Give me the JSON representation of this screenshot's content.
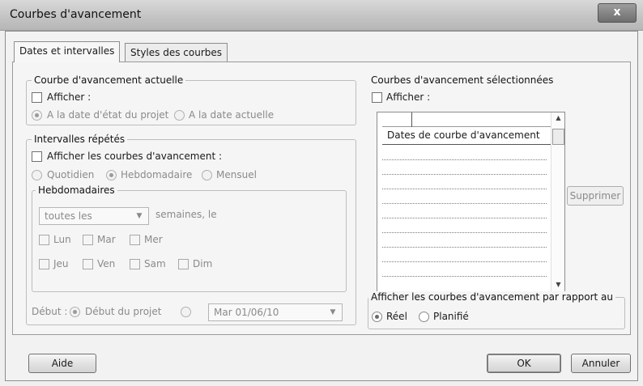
{
  "window": {
    "title": "Courbes d'avancement",
    "close_glyph": "x"
  },
  "tabs": [
    {
      "label": "Dates et intervalles"
    },
    {
      "label": "Styles des courbes"
    }
  ],
  "current": {
    "legend": "Courbe d'avancement actuelle",
    "show_label": "Afficher :",
    "radio_status_date": "A la date d'état du projet",
    "radio_current_date": "A la date actuelle"
  },
  "repeated": {
    "legend": "Intervalles répétés",
    "show_label": "Afficher les courbes d'avancement :",
    "radio_daily": "Quotidien",
    "radio_weekly": "Hebdomadaire",
    "radio_monthly": "Mensuel",
    "weekly": {
      "legend": "Hebdomadaires",
      "every_value": "toutes les",
      "weeks_suffix": "semaines, le",
      "days": [
        "Lun",
        "Mar",
        "Mer",
        "Jeu",
        "Ven",
        "Sam",
        "Dim"
      ]
    },
    "start_label": "Début :",
    "radio_project_start": "Début du projet",
    "start_date_value": "Mar 01/06/10"
  },
  "selected": {
    "legend": "Courbes d'avancement sélectionnées",
    "show_label": "Afficher :",
    "list_header": "Dates de courbe d'avancement",
    "delete_button": "Supprimer"
  },
  "relative": {
    "legend": "Afficher les courbes d'avancement par rapport au",
    "radio_actual": "Réel",
    "radio_planned": "Planifié"
  },
  "footer": {
    "help_button": "Aide",
    "ok_button": "OK",
    "cancel_button": "Annuler"
  }
}
